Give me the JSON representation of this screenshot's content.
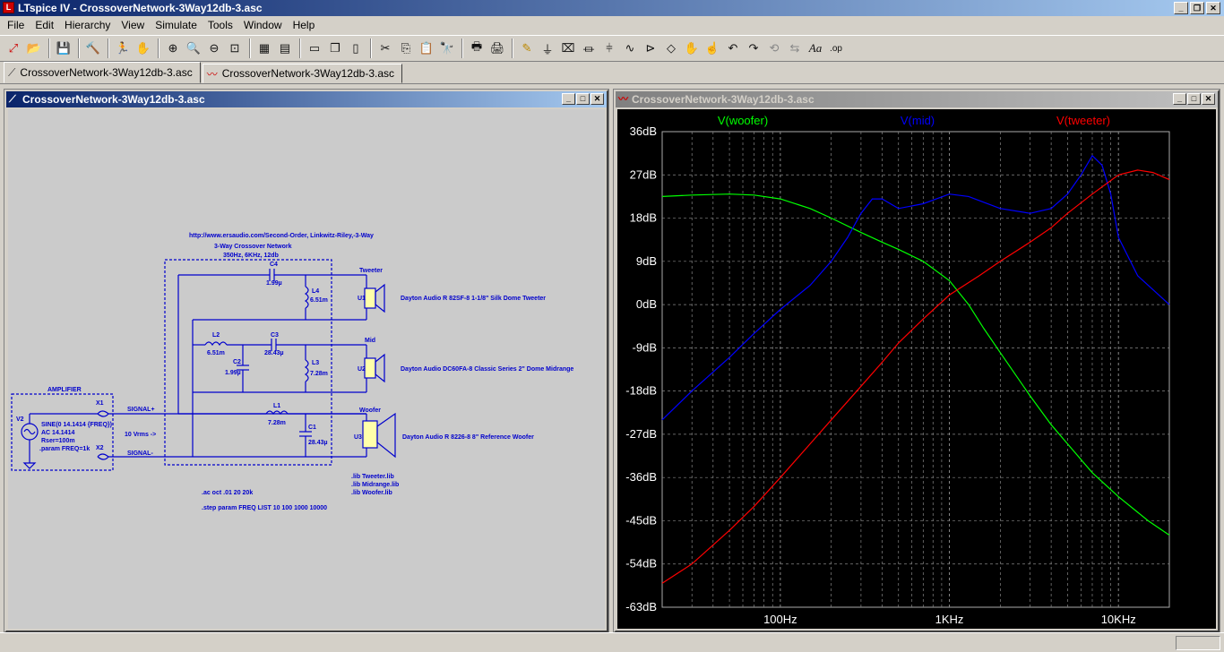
{
  "window": {
    "title": "LTspice IV - CrossoverNetwork-3Way12db-3.asc",
    "app_icon": "L"
  },
  "menu": [
    "File",
    "Edit",
    "Hierarchy",
    "View",
    "Simulate",
    "Tools",
    "Window",
    "Help"
  ],
  "tabs": [
    {
      "label": "CrossoverNetwork-3Way12db-3.asc",
      "icon": "schematic-icon"
    },
    {
      "label": "CrossoverNetwork-3Way12db-3.asc",
      "icon": "waveform-icon"
    }
  ],
  "schematic_window": {
    "title": "CrossoverNetwork-3Way12db-3.asc",
    "url_text": "http://www.ersaudio.com/Second-Order, Linkwitz-Riley,-3-Way",
    "net_title1": "3-Way Crossover Network",
    "net_title2": "350Hz, 6KHz, 12db",
    "amplifier": "AMPLIFIER",
    "v2": "V2",
    "source1": "SINE(0 14.1414 {FREQ})",
    "source2": "AC 14.1414",
    "source3": "Rser=100m",
    "source4": ".param FREQ=1k",
    "x1": "X1",
    "x2": "X2",
    "signal_plus": "SIGNAL+",
    "signal_minus": "SIGNAL-",
    "vrms": "10 Vrms ->",
    "c4": "C4",
    "c4v": "1.99µ",
    "l4": "L4",
    "l4v": "6.51m",
    "l2": "L2",
    "l2v": "6.51m",
    "c3": "C3",
    "c3v": "28.43µ",
    "c2": "C2",
    "c2v": "1.99µ",
    "l3": "L3",
    "l3v": "7.28m",
    "l1": "L1",
    "l1v": "7.28m",
    "c1": "C1",
    "c1v": "28.43µ",
    "tweeter": "Tweeter",
    "u1": "U1",
    "tweeter_desc": "Dayton Audio R 82SF-8 1-1/8\" Silk Dome Tweeter",
    "mid": "Mid",
    "u2": "U2",
    "mid_desc": "Dayton Audio DC60FA-8 Classic Series 2\" Dome Midrange",
    "woofer": "Woofer",
    "u3": "U3",
    "woofer_desc": "Dayton Audio R 8226-8 8\" Reference Woofer",
    "lib1": ".lib Tweeter.lib",
    "lib2": ".lib Midrange.lib",
    "lib3": ".lib Woofer.lib",
    "cmd_ac": ".ac oct .01 20 20k",
    "cmd_step": ".step param FREQ LIST 10 100 1000 10000"
  },
  "plot_window": {
    "title": "CrossoverNetwork-3Way12db-3.asc"
  },
  "chart_data": {
    "type": "line",
    "title": "",
    "xscale": "log",
    "xlim": [
      20,
      20000
    ],
    "ylim": [
      -63,
      36
    ],
    "yticks": [
      "36dB",
      "27dB",
      "18dB",
      "9dB",
      "0dB",
      "-9dB",
      "-18dB",
      "-27dB",
      "-36dB",
      "-45dB",
      "-54dB",
      "-63dB"
    ],
    "xticks": [
      "100Hz",
      "1KHz",
      "10KHz"
    ],
    "grid": true,
    "legend_position": "top",
    "series": [
      {
        "name": "V(woofer)",
        "color": "#00ff00",
        "x": [
          20,
          30,
          50,
          70,
          100,
          150,
          200,
          300,
          400,
          500,
          700,
          1000,
          1300,
          1600,
          2000,
          3000,
          4000,
          5000,
          7000,
          10000,
          15000,
          20000
        ],
        "y": [
          22.5,
          22.8,
          23,
          22.8,
          22,
          20,
          18,
          15,
          13,
          11.5,
          9,
          5,
          0,
          -5,
          -10,
          -19,
          -25,
          -29,
          -35,
          -40,
          -45,
          -48
        ]
      },
      {
        "name": "V(mid)",
        "color": "#0000ff",
        "x": [
          20,
          30,
          50,
          70,
          100,
          150,
          200,
          250,
          300,
          350,
          400,
          500,
          700,
          1000,
          1300,
          2000,
          3000,
          4000,
          5000,
          6000,
          7000,
          8000,
          9000,
          10000,
          13000,
          20000
        ],
        "y": [
          -24,
          -18,
          -11,
          -6,
          -1,
          4,
          9,
          14,
          19,
          22,
          22,
          20,
          21,
          23,
          22.5,
          20,
          19,
          20,
          23,
          27,
          31,
          29,
          23,
          14,
          6,
          0
        ]
      },
      {
        "name": "V(tweeter)",
        "color": "#ff0000",
        "x": [
          20,
          30,
          50,
          70,
          100,
          150,
          200,
          300,
          400,
          500,
          700,
          1000,
          1500,
          2000,
          3000,
          4000,
          5000,
          7000,
          10000,
          13000,
          16000,
          20000
        ],
        "y": [
          -58,
          -54,
          -47,
          -42,
          -36,
          -29,
          -24,
          -17,
          -12,
          -8,
          -3,
          2,
          6,
          9,
          13,
          16,
          19,
          23,
          27,
          28,
          27.5,
          26
        ]
      }
    ]
  }
}
